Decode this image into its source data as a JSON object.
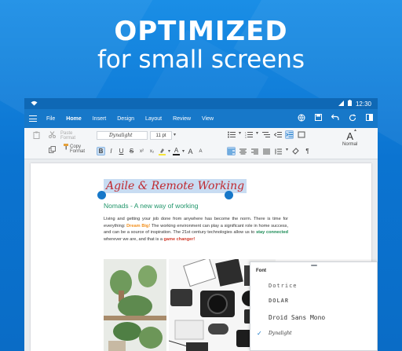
{
  "promo": {
    "title": "OPTIMIZED",
    "subtitle": "for small screens"
  },
  "status_bar": {
    "time": "12:30"
  },
  "menu_bar": {
    "items": [
      "File",
      "Home",
      "Insert",
      "Design",
      "Layout",
      "Review",
      "View"
    ],
    "active": "Home"
  },
  "ribbon": {
    "paste_format_label": "Paste Format",
    "copy_format_label": "Copy Format",
    "font_name": "Dynalight",
    "font_size": "11 pt",
    "style_name": "Normal",
    "style_glyph": "A",
    "bold": "B",
    "italic": "I",
    "underline": "U",
    "strike": "S",
    "grow": "A",
    "shrink": "A",
    "font_color": "A"
  },
  "document": {
    "heading": "Agile & Remote Working",
    "subheading": "Nomads - A new way of working",
    "body_part1": "Living and getting your job done from anywhere has become the norm. There is time for everything: ",
    "highlight1": "Dream Big!",
    "body_part2": " The working environment can play a significant role in home success, and can be a source of inspiration. The 21st century technologies allow us to ",
    "highlight2": "stay connected",
    "body_part3": " wherever we are, and that is a ",
    "highlight3": "game changer!"
  },
  "font_panel": {
    "title": "Font",
    "options": [
      "Dotrice",
      "DOLAR",
      "Droid Sans Mono",
      "Dynalight"
    ],
    "selected": "Dynalight"
  },
  "colors": {
    "brand_blue": "#1778c9",
    "heading_red": "#c0282f",
    "subheading_green": "#20956a"
  }
}
